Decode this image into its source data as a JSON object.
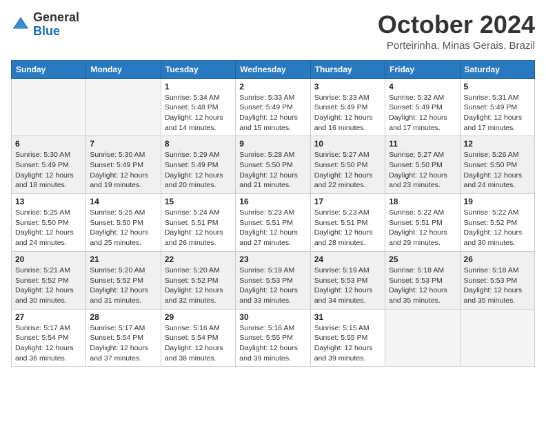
{
  "logo": {
    "text_general": "General",
    "text_blue": "Blue"
  },
  "title": "October 2024",
  "subtitle": "Porteirinha, Minas Gerais, Brazil",
  "days_of_week": [
    "Sunday",
    "Monday",
    "Tuesday",
    "Wednesday",
    "Thursday",
    "Friday",
    "Saturday"
  ],
  "weeks": [
    [
      {
        "day": "",
        "sunrise": "",
        "sunset": "",
        "daylight": ""
      },
      {
        "day": "",
        "sunrise": "",
        "sunset": "",
        "daylight": ""
      },
      {
        "day": "1",
        "sunrise": "Sunrise: 5:34 AM",
        "sunset": "Sunset: 5:48 PM",
        "daylight": "Daylight: 12 hours and 14 minutes."
      },
      {
        "day": "2",
        "sunrise": "Sunrise: 5:33 AM",
        "sunset": "Sunset: 5:49 PM",
        "daylight": "Daylight: 12 hours and 15 minutes."
      },
      {
        "day": "3",
        "sunrise": "Sunrise: 5:33 AM",
        "sunset": "Sunset: 5:49 PM",
        "daylight": "Daylight: 12 hours and 16 minutes."
      },
      {
        "day": "4",
        "sunrise": "Sunrise: 5:32 AM",
        "sunset": "Sunset: 5:49 PM",
        "daylight": "Daylight: 12 hours and 17 minutes."
      },
      {
        "day": "5",
        "sunrise": "Sunrise: 5:31 AM",
        "sunset": "Sunset: 5:49 PM",
        "daylight": "Daylight: 12 hours and 17 minutes."
      }
    ],
    [
      {
        "day": "6",
        "sunrise": "Sunrise: 5:30 AM",
        "sunset": "Sunset: 5:49 PM",
        "daylight": "Daylight: 12 hours and 18 minutes."
      },
      {
        "day": "7",
        "sunrise": "Sunrise: 5:30 AM",
        "sunset": "Sunset: 5:49 PM",
        "daylight": "Daylight: 12 hours and 19 minutes."
      },
      {
        "day": "8",
        "sunrise": "Sunrise: 5:29 AM",
        "sunset": "Sunset: 5:49 PM",
        "daylight": "Daylight: 12 hours and 20 minutes."
      },
      {
        "day": "9",
        "sunrise": "Sunrise: 5:28 AM",
        "sunset": "Sunset: 5:50 PM",
        "daylight": "Daylight: 12 hours and 21 minutes."
      },
      {
        "day": "10",
        "sunrise": "Sunrise: 5:27 AM",
        "sunset": "Sunset: 5:50 PM",
        "daylight": "Daylight: 12 hours and 22 minutes."
      },
      {
        "day": "11",
        "sunrise": "Sunrise: 5:27 AM",
        "sunset": "Sunset: 5:50 PM",
        "daylight": "Daylight: 12 hours and 23 minutes."
      },
      {
        "day": "12",
        "sunrise": "Sunrise: 5:26 AM",
        "sunset": "Sunset: 5:50 PM",
        "daylight": "Daylight: 12 hours and 24 minutes."
      }
    ],
    [
      {
        "day": "13",
        "sunrise": "Sunrise: 5:25 AM",
        "sunset": "Sunset: 5:50 PM",
        "daylight": "Daylight: 12 hours and 24 minutes."
      },
      {
        "day": "14",
        "sunrise": "Sunrise: 5:25 AM",
        "sunset": "Sunset: 5:50 PM",
        "daylight": "Daylight: 12 hours and 25 minutes."
      },
      {
        "day": "15",
        "sunrise": "Sunrise: 5:24 AM",
        "sunset": "Sunset: 5:51 PM",
        "daylight": "Daylight: 12 hours and 26 minutes."
      },
      {
        "day": "16",
        "sunrise": "Sunrise: 5:23 AM",
        "sunset": "Sunset: 5:51 PM",
        "daylight": "Daylight: 12 hours and 27 minutes."
      },
      {
        "day": "17",
        "sunrise": "Sunrise: 5:23 AM",
        "sunset": "Sunset: 5:51 PM",
        "daylight": "Daylight: 12 hours and 28 minutes."
      },
      {
        "day": "18",
        "sunrise": "Sunrise: 5:22 AM",
        "sunset": "Sunset: 5:51 PM",
        "daylight": "Daylight: 12 hours and 29 minutes."
      },
      {
        "day": "19",
        "sunrise": "Sunrise: 5:22 AM",
        "sunset": "Sunset: 5:52 PM",
        "daylight": "Daylight: 12 hours and 30 minutes."
      }
    ],
    [
      {
        "day": "20",
        "sunrise": "Sunrise: 5:21 AM",
        "sunset": "Sunset: 5:52 PM",
        "daylight": "Daylight: 12 hours and 30 minutes."
      },
      {
        "day": "21",
        "sunrise": "Sunrise: 5:20 AM",
        "sunset": "Sunset: 5:52 PM",
        "daylight": "Daylight: 12 hours and 31 minutes."
      },
      {
        "day": "22",
        "sunrise": "Sunrise: 5:20 AM",
        "sunset": "Sunset: 5:52 PM",
        "daylight": "Daylight: 12 hours and 32 minutes."
      },
      {
        "day": "23",
        "sunrise": "Sunrise: 5:19 AM",
        "sunset": "Sunset: 5:53 PM",
        "daylight": "Daylight: 12 hours and 33 minutes."
      },
      {
        "day": "24",
        "sunrise": "Sunrise: 5:19 AM",
        "sunset": "Sunset: 5:53 PM",
        "daylight": "Daylight: 12 hours and 34 minutes."
      },
      {
        "day": "25",
        "sunrise": "Sunrise: 5:18 AM",
        "sunset": "Sunset: 5:53 PM",
        "daylight": "Daylight: 12 hours and 35 minutes."
      },
      {
        "day": "26",
        "sunrise": "Sunrise: 5:18 AM",
        "sunset": "Sunset: 5:53 PM",
        "daylight": "Daylight: 12 hours and 35 minutes."
      }
    ],
    [
      {
        "day": "27",
        "sunrise": "Sunrise: 5:17 AM",
        "sunset": "Sunset: 5:54 PM",
        "daylight": "Daylight: 12 hours and 36 minutes."
      },
      {
        "day": "28",
        "sunrise": "Sunrise: 5:17 AM",
        "sunset": "Sunset: 5:54 PM",
        "daylight": "Daylight: 12 hours and 37 minutes."
      },
      {
        "day": "29",
        "sunrise": "Sunrise: 5:16 AM",
        "sunset": "Sunset: 5:54 PM",
        "daylight": "Daylight: 12 hours and 38 minutes."
      },
      {
        "day": "30",
        "sunrise": "Sunrise: 5:16 AM",
        "sunset": "Sunset: 5:55 PM",
        "daylight": "Daylight: 12 hours and 39 minutes."
      },
      {
        "day": "31",
        "sunrise": "Sunrise: 5:15 AM",
        "sunset": "Sunset: 5:55 PM",
        "daylight": "Daylight: 12 hours and 39 minutes."
      },
      {
        "day": "",
        "sunrise": "",
        "sunset": "",
        "daylight": ""
      },
      {
        "day": "",
        "sunrise": "",
        "sunset": "",
        "daylight": ""
      }
    ]
  ]
}
